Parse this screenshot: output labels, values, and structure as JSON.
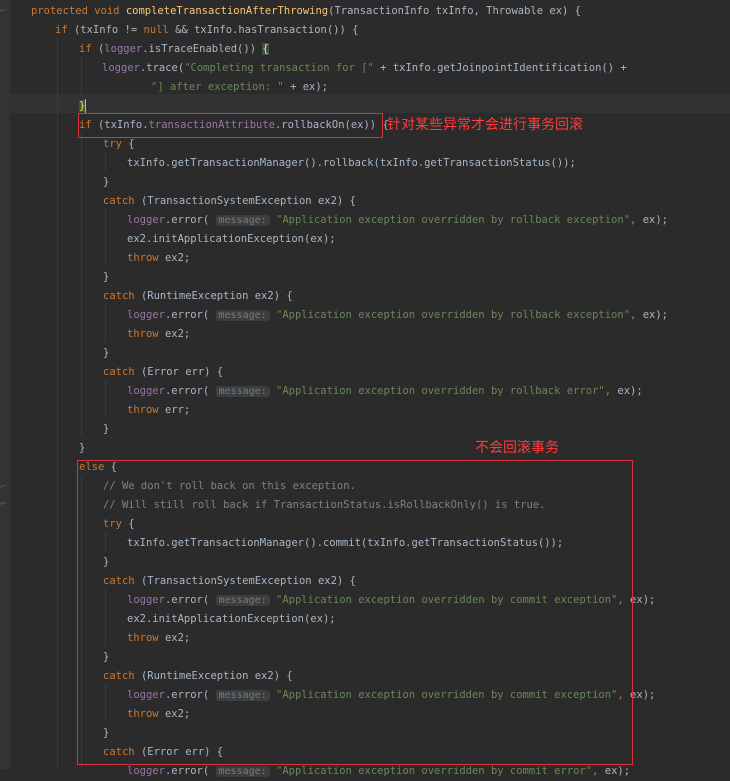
{
  "editor": {
    "lines": [
      [
        [
          "kw",
          "protected "
        ],
        [
          "kw",
          "void "
        ],
        [
          "fn",
          "completeTransactionAfterThrowing"
        ],
        [
          "pl",
          "(TransactionInfo txInfo, Throwable ex) {"
        ]
      ],
      [
        [
          "kw",
          "if "
        ],
        [
          "pl",
          "(txInfo != "
        ],
        [
          "kw",
          "null "
        ],
        [
          "pl",
          "&& txInfo.hasTransaction()) {"
        ]
      ],
      [
        [
          "kw",
          "if "
        ],
        [
          "pl",
          "("
        ],
        [
          "fld",
          "logger"
        ],
        [
          "pl",
          ".isTraceEnabled()) "
        ],
        [
          "br",
          "{"
        ]
      ],
      [
        [
          "fld",
          "logger"
        ],
        [
          "pl",
          ".trace("
        ],
        [
          "str",
          "\"Completing transaction for [\" "
        ],
        [
          "pl",
          "+ txInfo.getJoinpointIdentification() +"
        ]
      ],
      [
        [
          "str",
          "\"] after exception: \" "
        ],
        [
          "pl",
          "+ ex);"
        ]
      ],
      [
        [
          "br",
          "}"
        ],
        [
          "caret",
          ""
        ]
      ],
      [
        [
          "kw",
          "if "
        ],
        [
          "pl",
          "(txInfo."
        ],
        [
          "fld",
          "transactionAttribute"
        ],
        [
          "pl",
          ".rollbackOn(ex)) {"
        ]
      ],
      [
        [
          "kw",
          "try "
        ],
        [
          "pl",
          "{"
        ]
      ],
      [
        [
          "pl",
          "txInfo.getTransactionManager().rollback(txInfo.getTransactionStatus());"
        ]
      ],
      [
        [
          "pl",
          "}"
        ]
      ],
      [
        [
          "kw",
          "catch "
        ],
        [
          "pl",
          "(TransactionSystemException ex2) {"
        ]
      ],
      [
        [
          "fld",
          "logger"
        ],
        [
          "pl",
          ".error( "
        ],
        [
          "hint",
          "message:"
        ],
        [
          "pl",
          " "
        ],
        [
          "str",
          "\"Application exception overridden by rollback exception\""
        ],
        [
          "kw",
          ", "
        ],
        [
          "pl",
          "ex);"
        ]
      ],
      [
        [
          "pl",
          "ex2.initApplicationException(ex);"
        ]
      ],
      [
        [
          "kw",
          "throw "
        ],
        [
          "pl",
          "ex2;"
        ]
      ],
      [
        [
          "pl",
          "}"
        ]
      ],
      [
        [
          "kw",
          "catch "
        ],
        [
          "pl",
          "(RuntimeException ex2) {"
        ]
      ],
      [
        [
          "fld",
          "logger"
        ],
        [
          "pl",
          ".error( "
        ],
        [
          "hint",
          "message:"
        ],
        [
          "pl",
          " "
        ],
        [
          "str",
          "\"Application exception overridden by rollback exception\""
        ],
        [
          "kw",
          ", "
        ],
        [
          "pl",
          "ex);"
        ]
      ],
      [
        [
          "kw",
          "throw "
        ],
        [
          "pl",
          "ex2;"
        ]
      ],
      [
        [
          "pl",
          "}"
        ]
      ],
      [
        [
          "kw",
          "catch "
        ],
        [
          "pl",
          "(Error err) {"
        ]
      ],
      [
        [
          "fld",
          "logger"
        ],
        [
          "pl",
          ".error( "
        ],
        [
          "hint",
          "message:"
        ],
        [
          "pl",
          " "
        ],
        [
          "str",
          "\"Application exception overridden by rollback error\""
        ],
        [
          "kw",
          ", "
        ],
        [
          "pl",
          "ex);"
        ]
      ],
      [
        [
          "kw",
          "throw "
        ],
        [
          "pl",
          "err;"
        ]
      ],
      [
        [
          "pl",
          "}"
        ]
      ],
      [
        [
          "pl",
          "}"
        ]
      ],
      [
        [
          "kw",
          "else "
        ],
        [
          "pl",
          "{"
        ]
      ],
      [
        [
          "cmt",
          "// We don't roll back on this exception."
        ]
      ],
      [
        [
          "cmt",
          "// Will still roll back if TransactionStatus.isRollbackOnly() is true."
        ]
      ],
      [
        [
          "kw",
          "try "
        ],
        [
          "pl",
          "{"
        ]
      ],
      [
        [
          "pl",
          "txInfo.getTransactionManager().commit(txInfo.getTransactionStatus());"
        ]
      ],
      [
        [
          "pl",
          "}"
        ]
      ],
      [
        [
          "kw",
          "catch "
        ],
        [
          "pl",
          "(TransactionSystemException ex2) {"
        ]
      ],
      [
        [
          "fld",
          "logger"
        ],
        [
          "pl",
          ".error( "
        ],
        [
          "hint",
          "message:"
        ],
        [
          "pl",
          " "
        ],
        [
          "str",
          "\"Application exception overridden by commit exception\""
        ],
        [
          "kw",
          ", "
        ],
        [
          "pl",
          "ex);"
        ]
      ],
      [
        [
          "pl",
          "ex2.initApplicationException(ex);"
        ]
      ],
      [
        [
          "kw",
          "throw "
        ],
        [
          "pl",
          "ex2;"
        ]
      ],
      [
        [
          "pl",
          "}"
        ]
      ],
      [
        [
          "kw",
          "catch "
        ],
        [
          "pl",
          "(RuntimeException ex2) {"
        ]
      ],
      [
        [
          "fld",
          "logger"
        ],
        [
          "pl",
          ".error( "
        ],
        [
          "hint",
          "message:"
        ],
        [
          "pl",
          " "
        ],
        [
          "str",
          "\"Application exception overridden by commit exception\""
        ],
        [
          "kw",
          ", "
        ],
        [
          "pl",
          "ex);"
        ]
      ],
      [
        [
          "kw",
          "throw "
        ],
        [
          "pl",
          "ex2;"
        ]
      ],
      [
        [
          "pl",
          "}"
        ]
      ],
      [
        [
          "kw",
          "catch "
        ],
        [
          "pl",
          "(Error err) {"
        ]
      ],
      [
        [
          "fld",
          "logger"
        ],
        [
          "pl",
          ".error( "
        ],
        [
          "hint",
          "message:"
        ],
        [
          "pl",
          " "
        ],
        [
          "str",
          "\"Application exception overridden by commit error\""
        ],
        [
          "kw",
          ", "
        ],
        [
          "pl",
          "ex);"
        ]
      ]
    ]
  },
  "annotations": {
    "rollback_note": "针对某些异常才会进行事务回滚",
    "commit_note": "不会回滚事务"
  },
  "colors": {
    "background": "#2b2b2b",
    "keyword": "#cc7832",
    "method": "#ffc66d",
    "string": "#6a8759",
    "field": "#9876aa",
    "comment": "#808080",
    "annotation_red": "#ff3b3b"
  }
}
